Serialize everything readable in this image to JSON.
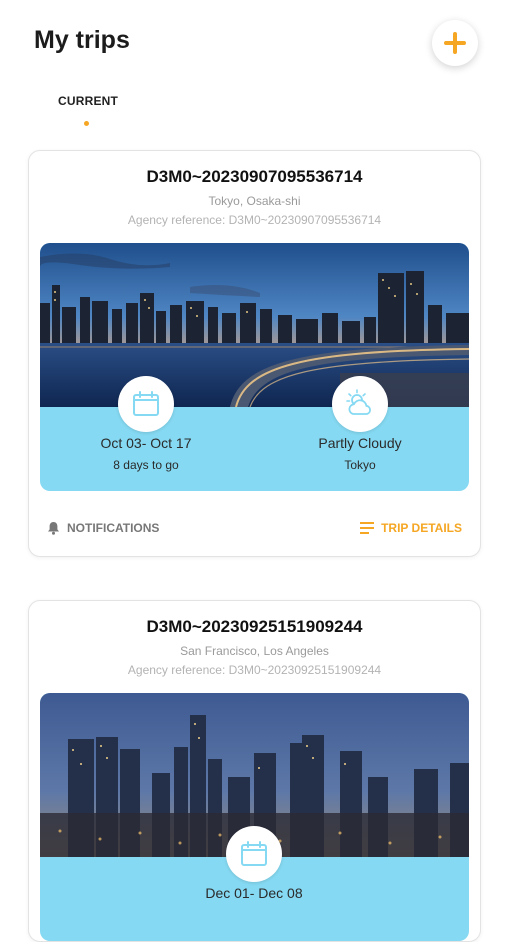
{
  "header": {
    "title": "My trips",
    "add_icon": "plus-icon",
    "accent": "#f5a623"
  },
  "tabs": [
    {
      "label": "CURRENT",
      "active": true
    }
  ],
  "trips": [
    {
      "code": "D3M0~20230907095536714",
      "cities": "Tokyo, Osaka-shi",
      "agency": "Agency reference: D3M0~20230907095536714",
      "dates": "Oct 03- Oct 17",
      "countdown": "8 days to go",
      "weather": "Partly Cloudy",
      "weather_city": "Tokyo",
      "notifications_label": "NOTIFICATIONS",
      "details_label": "TRIP DETAILS"
    },
    {
      "code": "D3M0~20230925151909244",
      "cities": "San Francisco, Los Angeles",
      "agency": "Agency reference: D3M0~20230925151909244",
      "dates": "Dec 01- Dec 08"
    }
  ],
  "colors": {
    "info_panel": "#85d9f2",
    "accent": "#f5a623"
  }
}
